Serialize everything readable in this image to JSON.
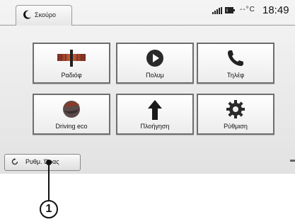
{
  "status_bar": {
    "mode_label": "Σκούρο",
    "temperature": "--°C",
    "time": "18:49"
  },
  "tiles": [
    {
      "label": "Ραδιόφ",
      "icon": "radio-tuner-icon"
    },
    {
      "label": "Πολυμ",
      "icon": "media-play-icon"
    },
    {
      "label": "Τηλέφ",
      "icon": "phone-handset-icon"
    },
    {
      "label": "Driving eco",
      "icon": "eco-leaf-icon"
    },
    {
      "label": "Πλοήγηση",
      "icon": "navigation-arrow-icon"
    },
    {
      "label": "Ρύθμιση",
      "icon": "settings-gear-icon"
    }
  ],
  "bottom_button": {
    "label": "Ρυθμ. Ώρας",
    "icon": "refresh-icon"
  },
  "callout": {
    "number": "1"
  },
  "colors": {
    "tile_border": "#6e6e6e",
    "screen_bg": "#e9e9e9"
  }
}
